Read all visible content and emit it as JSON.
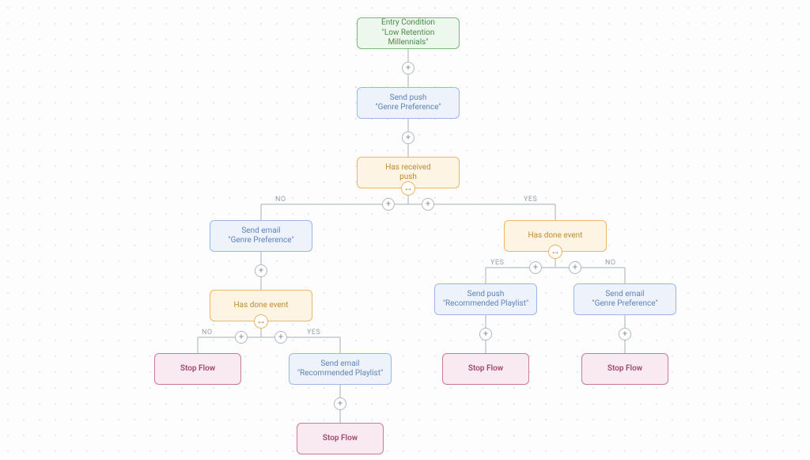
{
  "nodes": {
    "entry": {
      "line1": "Entry Condition",
      "line2": "\"Low Retention Millennials\""
    },
    "push1": {
      "line1": "Send push",
      "line2": "\"Genre Preference\""
    },
    "cond1": {
      "line1": "Has received",
      "line2": "push"
    },
    "emailGP1": {
      "line1": "Send email",
      "line2": "\"Genre Preference\""
    },
    "cond2": {
      "line1": "Has done event",
      "line2": ""
    },
    "condL": {
      "line1": "Has done event",
      "line2": ""
    },
    "pushRP": {
      "line1": "Send push",
      "line2": "\"Recommended Playlist\""
    },
    "emailGP2": {
      "line1": "Send email",
      "line2": "\"Genre Preference\""
    },
    "emailRP": {
      "line1": "Send email",
      "line2": "\"Recommended Playlist\""
    },
    "stop": {
      "label": "Stop Flow"
    }
  },
  "labels": {
    "yes": "YES",
    "no": "NO"
  },
  "icons": {
    "plus": "+",
    "branch": "↔"
  }
}
